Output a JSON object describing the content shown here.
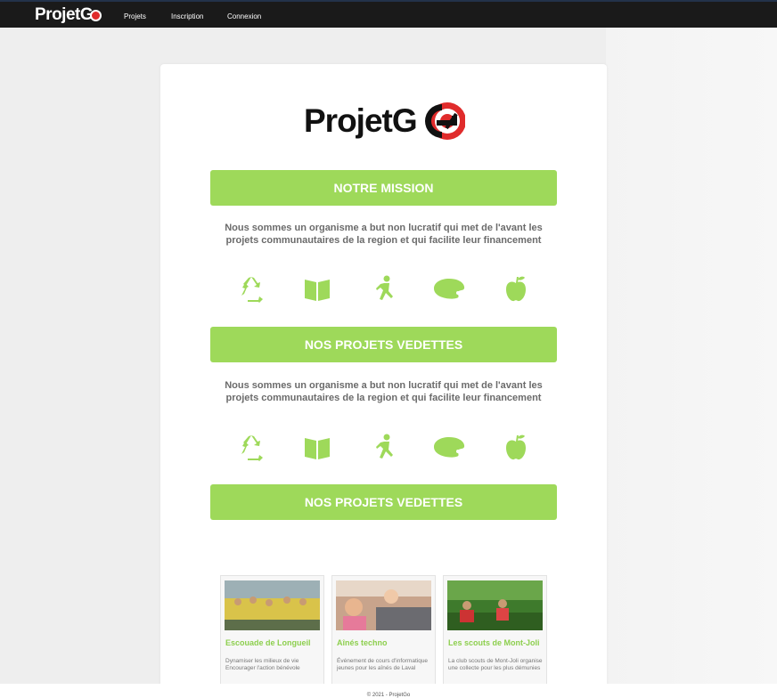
{
  "topbar": {
    "brand": "ProjetG",
    "nav": [
      "Projets",
      "Inscription",
      "Connexion"
    ]
  },
  "logo": {
    "text": "ProjetG"
  },
  "sections": [
    {
      "banner": "NOTRE MISSION",
      "text": "Nous sommes un organisme a but non lucratif qui met de l'avant les projets communautaires de la region et qui facilite leur financement"
    },
    {
      "banner": "NOS PROJETS VEDETTES",
      "text": "Nous sommes un organisme a but non lucratif qui met de l'avant les projets communautaires de la region et qui facilite leur financement"
    },
    {
      "banner": "NOS PROJETS VEDETTES"
    }
  ],
  "icons": [
    "recycle-icon",
    "book-icon",
    "runner-icon",
    "palette-icon",
    "apple-icon"
  ],
  "projects": [
    {
      "title": "Escouade de Longueil",
      "desc": "Dynamiser les milieux de vie Encourager l'action bénévole"
    },
    {
      "title": "Aînés techno",
      "desc": "Événement de cours d'informatique jeunes pour les aînés de Laval"
    },
    {
      "title": "Les scouts de Mont-Joli",
      "desc": "La club scouts de Mont-Joli organise une collecte pour les plus démunies"
    }
  ],
  "footer": "© 2021 - ProjetGo",
  "colors": {
    "accent": "#9ed95a",
    "brand_red": "#e02b2b",
    "topbar": "#1a1a1a"
  }
}
